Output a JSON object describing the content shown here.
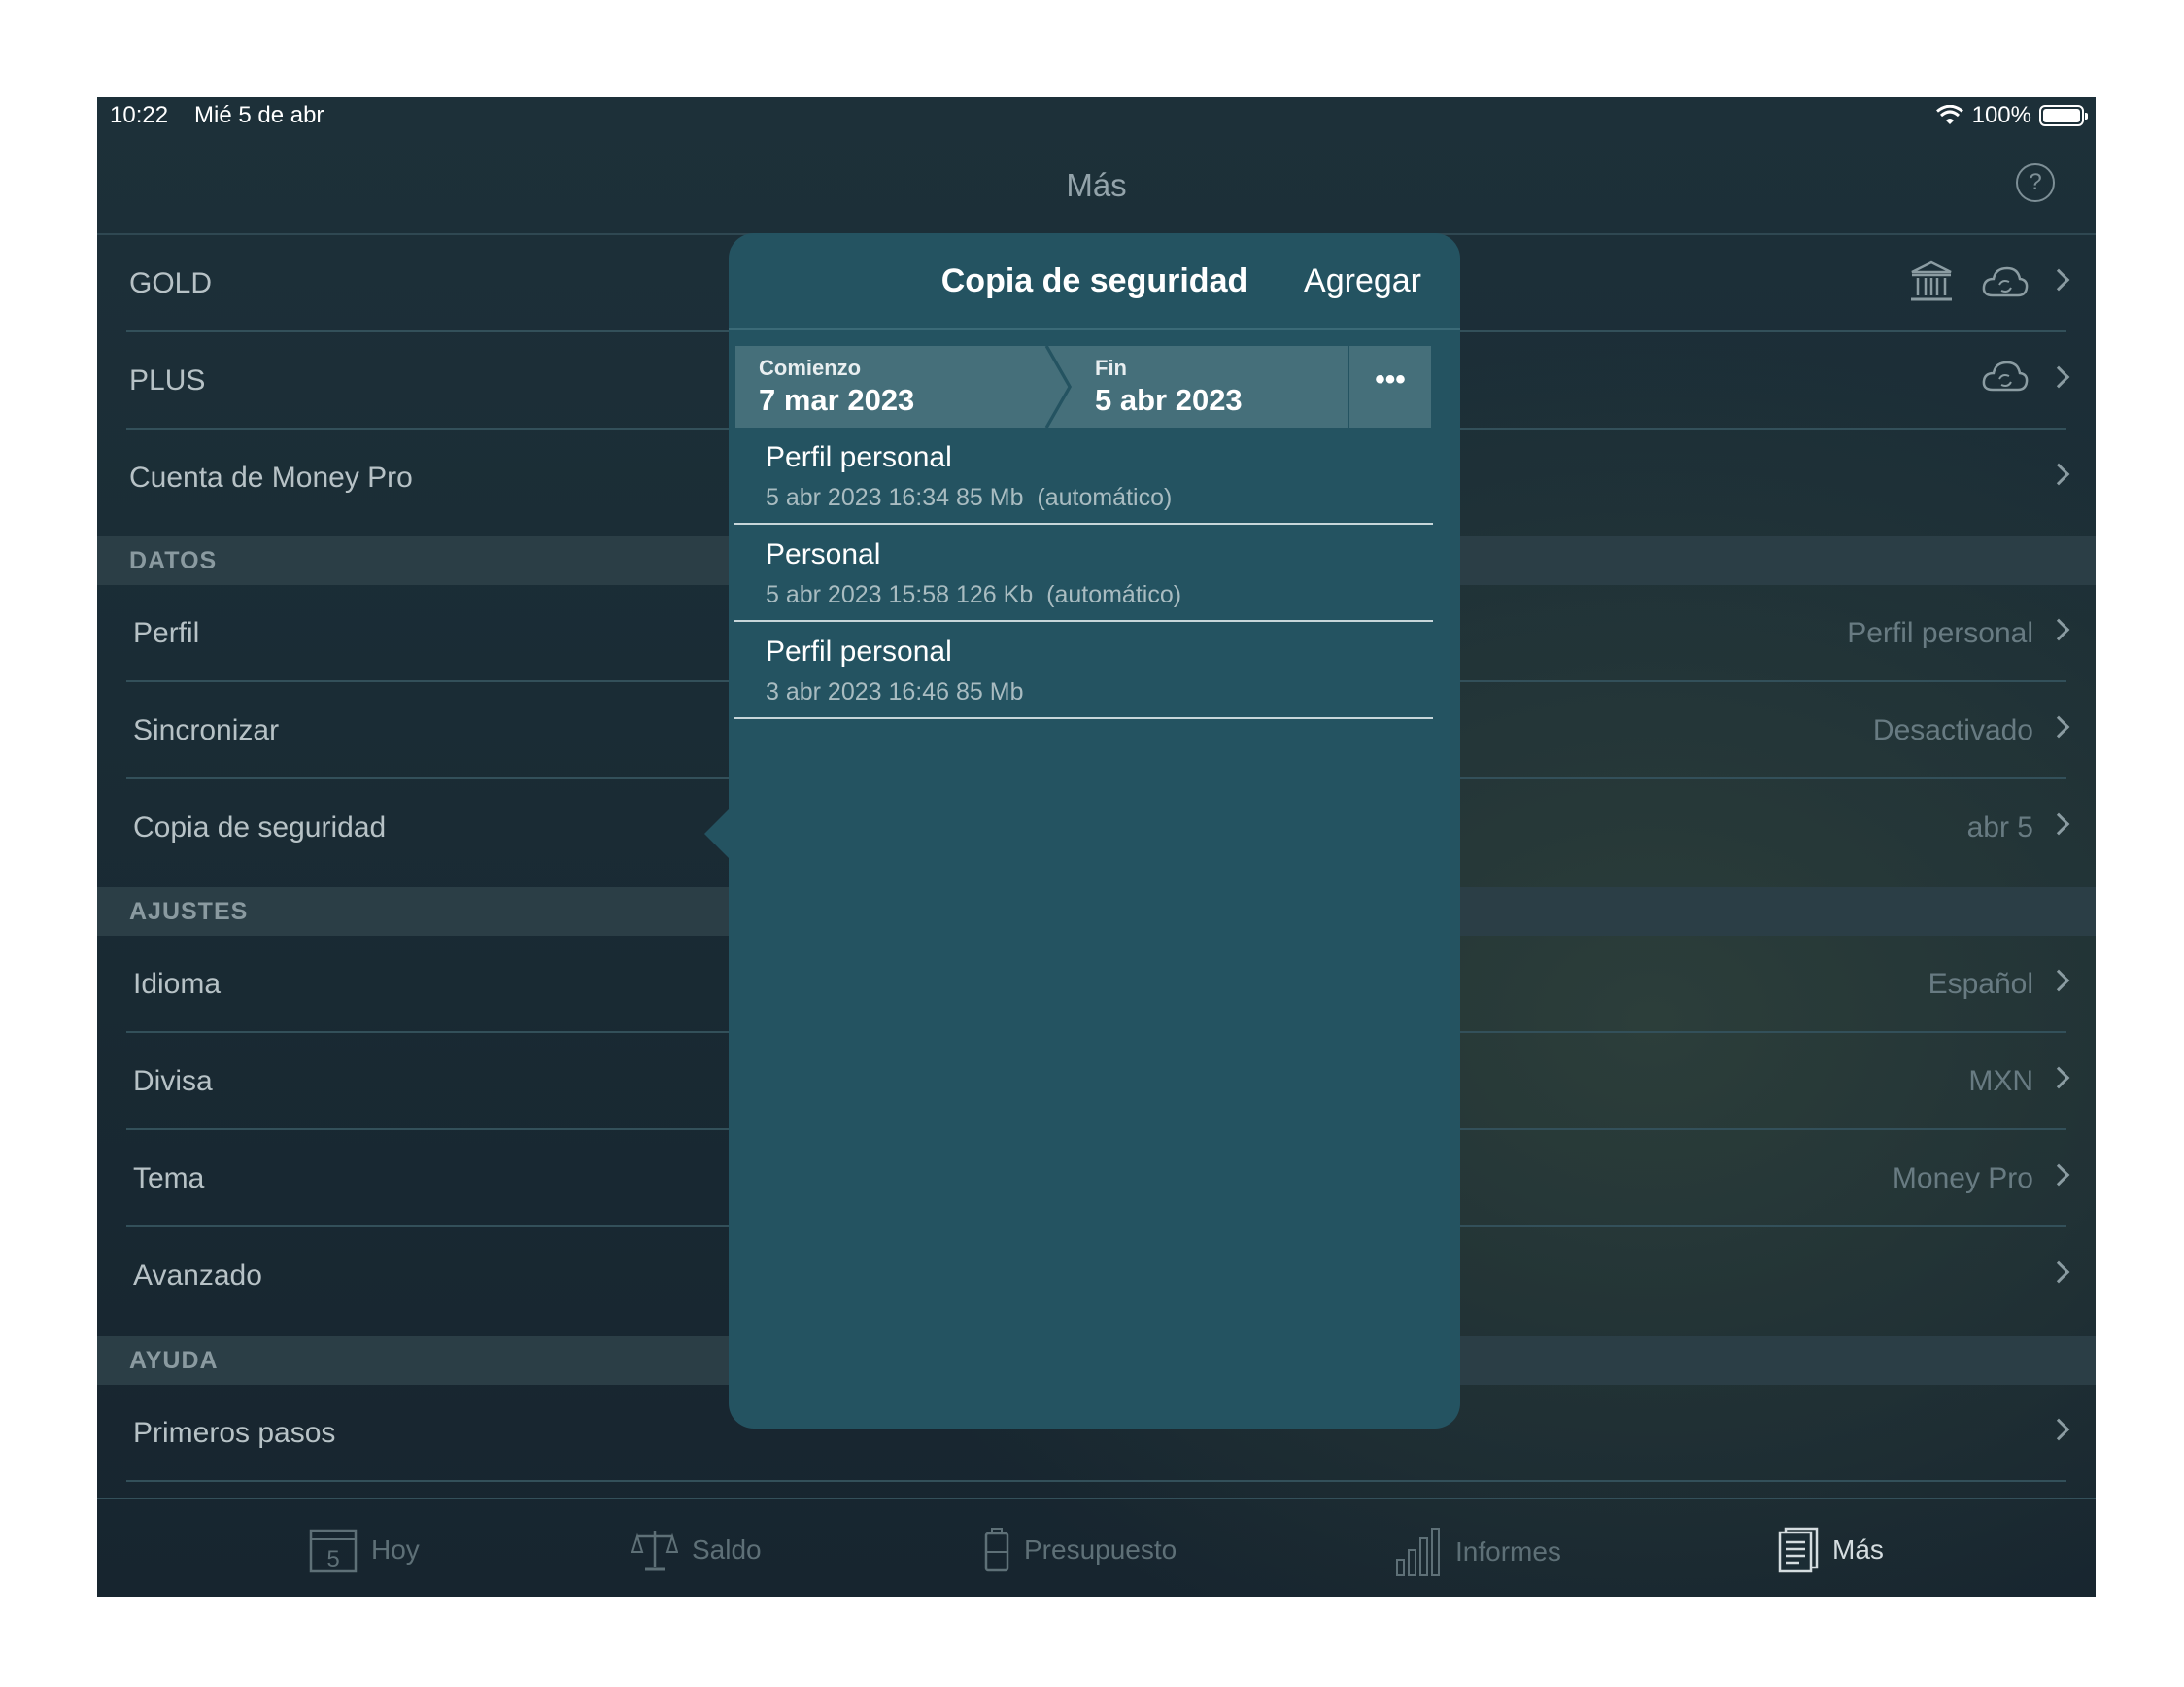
{
  "status_bar": {
    "time": "10:22",
    "date": "Mié 5 de abr",
    "battery": "100%"
  },
  "nav": {
    "title": "Más",
    "help_icon": "question-circle-icon"
  },
  "list": {
    "gold_label": "GOLD",
    "plus_label": "PLUS",
    "account_label": "Cuenta de Money Pro",
    "section_datos": "DATOS",
    "perfil_label": "Perfil",
    "perfil_value": "Perfil personal",
    "sync_label": "Sincronizar",
    "sync_value": "Desactivado",
    "backup_label": "Copia de seguridad",
    "backup_value": "abr 5",
    "section_ajustes": "AJUSTES",
    "idioma_label": "Idioma",
    "idioma_value": "Español",
    "divisa_label": "Divisa",
    "divisa_value": "MXN",
    "tema_label": "Tema",
    "tema_value": "Money Pro",
    "avanzado_label": "Avanzado",
    "section_ayuda": "AYUDA",
    "primeros_label": "Primeros pasos"
  },
  "popover": {
    "title": "Copia de seguridad",
    "add_label": "Agregar",
    "start_label": "Comienzo",
    "start_value": "7 mar 2023",
    "end_label": "Fin",
    "end_value": "5 abr 2023",
    "more_label": "•••",
    "backups": [
      {
        "name": "Perfil personal",
        "meta": "5 abr 2023 16:34 85 Mb  (automático)"
      },
      {
        "name": "Personal",
        "meta": "5 abr 2023 15:58 126 Kb  (automático)"
      },
      {
        "name": "Perfil personal",
        "meta": "3 abr 2023 16:46 85 Mb"
      }
    ]
  },
  "tabs": [
    {
      "label": "Hoy",
      "icon": "calendar-icon",
      "badge": "5"
    },
    {
      "label": "Saldo",
      "icon": "scale-icon"
    },
    {
      "label": "Presupuesto",
      "icon": "battery-budget-icon"
    },
    {
      "label": "Informes",
      "icon": "bar-chart-icon"
    },
    {
      "label": "Más",
      "icon": "document-icon",
      "active": true
    }
  ]
}
